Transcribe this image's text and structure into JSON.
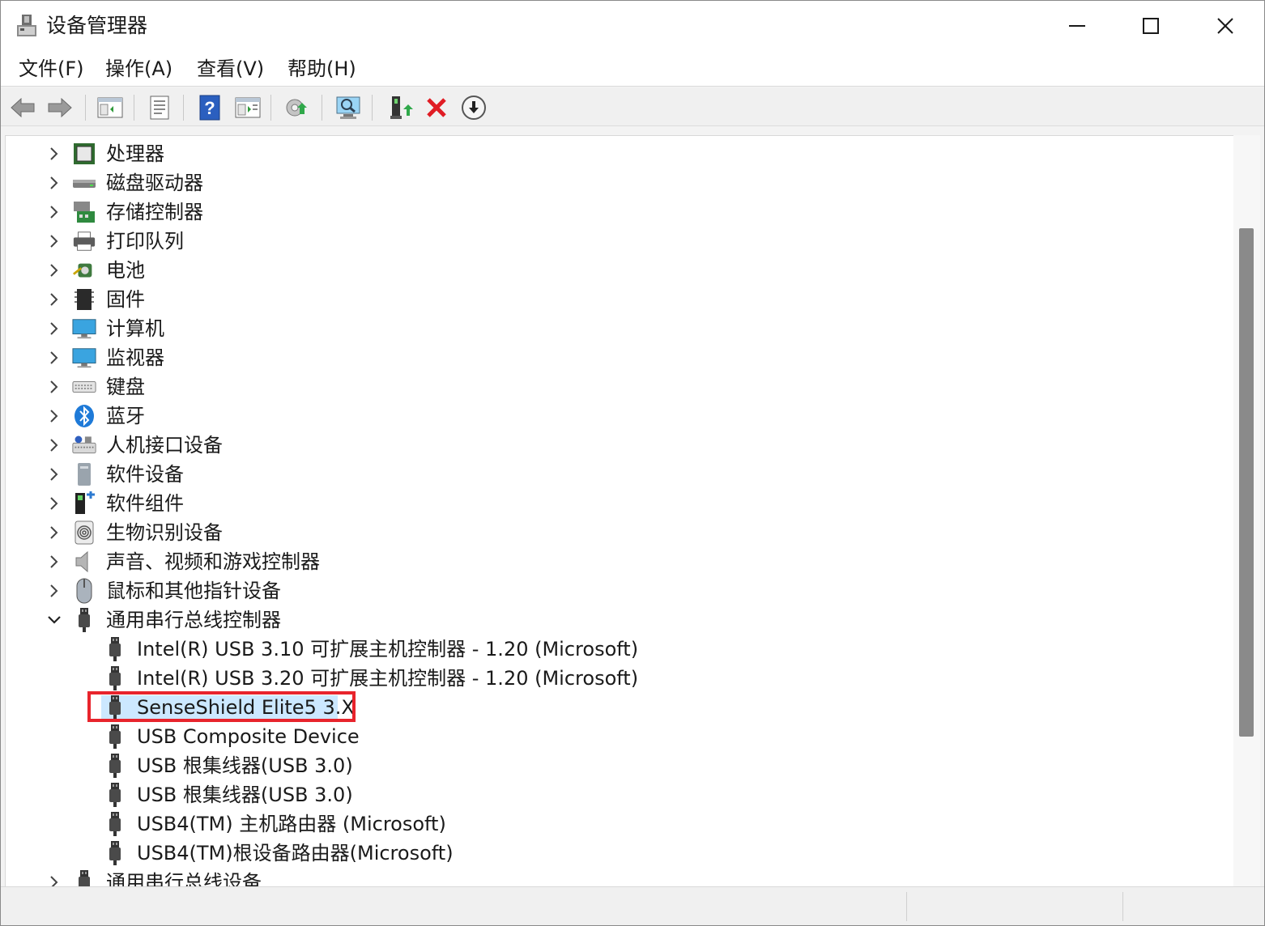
{
  "window": {
    "title": "设备管理器",
    "app_icon": "device-manager-icon",
    "controls": [
      "minimize-icon",
      "maximize-icon",
      "close-icon"
    ]
  },
  "menu": {
    "file": "文件(F)",
    "action": "操作(A)",
    "view": "查看(V)",
    "help": "帮助(H)"
  },
  "toolbar": {
    "buttons": [
      "back-arrow-icon",
      "forward-arrow-icon",
      "show-hide-console-tree-icon",
      "properties-icon",
      "help-icon",
      "export-list-icon",
      "update-driver-icon",
      "scan-hardware-icon",
      "enable-device-icon",
      "uninstall-icon",
      "disable-icon"
    ]
  },
  "tree": {
    "categories": [
      {
        "label": "处理器",
        "icon": "processor-icon",
        "expanded": false
      },
      {
        "label": "磁盘驱动器",
        "icon": "disk-drive-icon",
        "expanded": false
      },
      {
        "label": "存储控制器",
        "icon": "storage-controller-icon",
        "expanded": false
      },
      {
        "label": "打印队列",
        "icon": "printer-icon",
        "expanded": false
      },
      {
        "label": "电池",
        "icon": "battery-icon",
        "expanded": false
      },
      {
        "label": "固件",
        "icon": "firmware-icon",
        "expanded": false
      },
      {
        "label": "计算机",
        "icon": "computer-icon",
        "expanded": false
      },
      {
        "label": "监视器",
        "icon": "monitor-icon",
        "expanded": false
      },
      {
        "label": "键盘",
        "icon": "keyboard-icon",
        "expanded": false
      },
      {
        "label": "蓝牙",
        "icon": "bluetooth-icon",
        "expanded": false
      },
      {
        "label": "人机接口设备",
        "icon": "hid-icon",
        "expanded": false
      },
      {
        "label": "软件设备",
        "icon": "software-device-icon",
        "expanded": false
      },
      {
        "label": "软件组件",
        "icon": "software-component-icon",
        "expanded": false
      },
      {
        "label": "生物识别设备",
        "icon": "biometric-icon",
        "expanded": false
      },
      {
        "label": "声音、视频和游戏控制器",
        "icon": "speaker-icon",
        "expanded": false
      },
      {
        "label": "鼠标和其他指针设备",
        "icon": "mouse-icon",
        "expanded": false
      },
      {
        "label": "通用串行总线控制器",
        "icon": "usb-icon",
        "expanded": true
      }
    ],
    "usb_children": [
      {
        "label": "Intel(R) USB 3.10 可扩展主机控制器 - 1.20 (Microsoft)",
        "icon": "usb-plug-icon"
      },
      {
        "label": "Intel(R) USB 3.20 可扩展主机控制器 - 1.20 (Microsoft)",
        "icon": "usb-plug-icon"
      },
      {
        "label": "SenseShield Elite5 3.X",
        "icon": "usb-plug-icon",
        "selected": true
      },
      {
        "label": "USB Composite Device",
        "icon": "usb-plug-icon"
      },
      {
        "label": "USB 根集线器(USB 3.0)",
        "icon": "usb-plug-icon"
      },
      {
        "label": "USB 根集线器(USB 3.0)",
        "icon": "usb-plug-icon"
      },
      {
        "label": "USB4(TM) 主机路由器 (Microsoft)",
        "icon": "usb-plug-icon"
      },
      {
        "label": "USB4(TM)根设备路由器(Microsoft)",
        "icon": "usb-plug-icon"
      }
    ],
    "trailing_category": {
      "label": "通用串行总线设备",
      "icon": "usb-icon",
      "expanded": false
    }
  },
  "colors": {
    "selection": "#cce8ff",
    "highlight_box": "#e8242c",
    "scroll_thumb": "#8a8a8a"
  }
}
